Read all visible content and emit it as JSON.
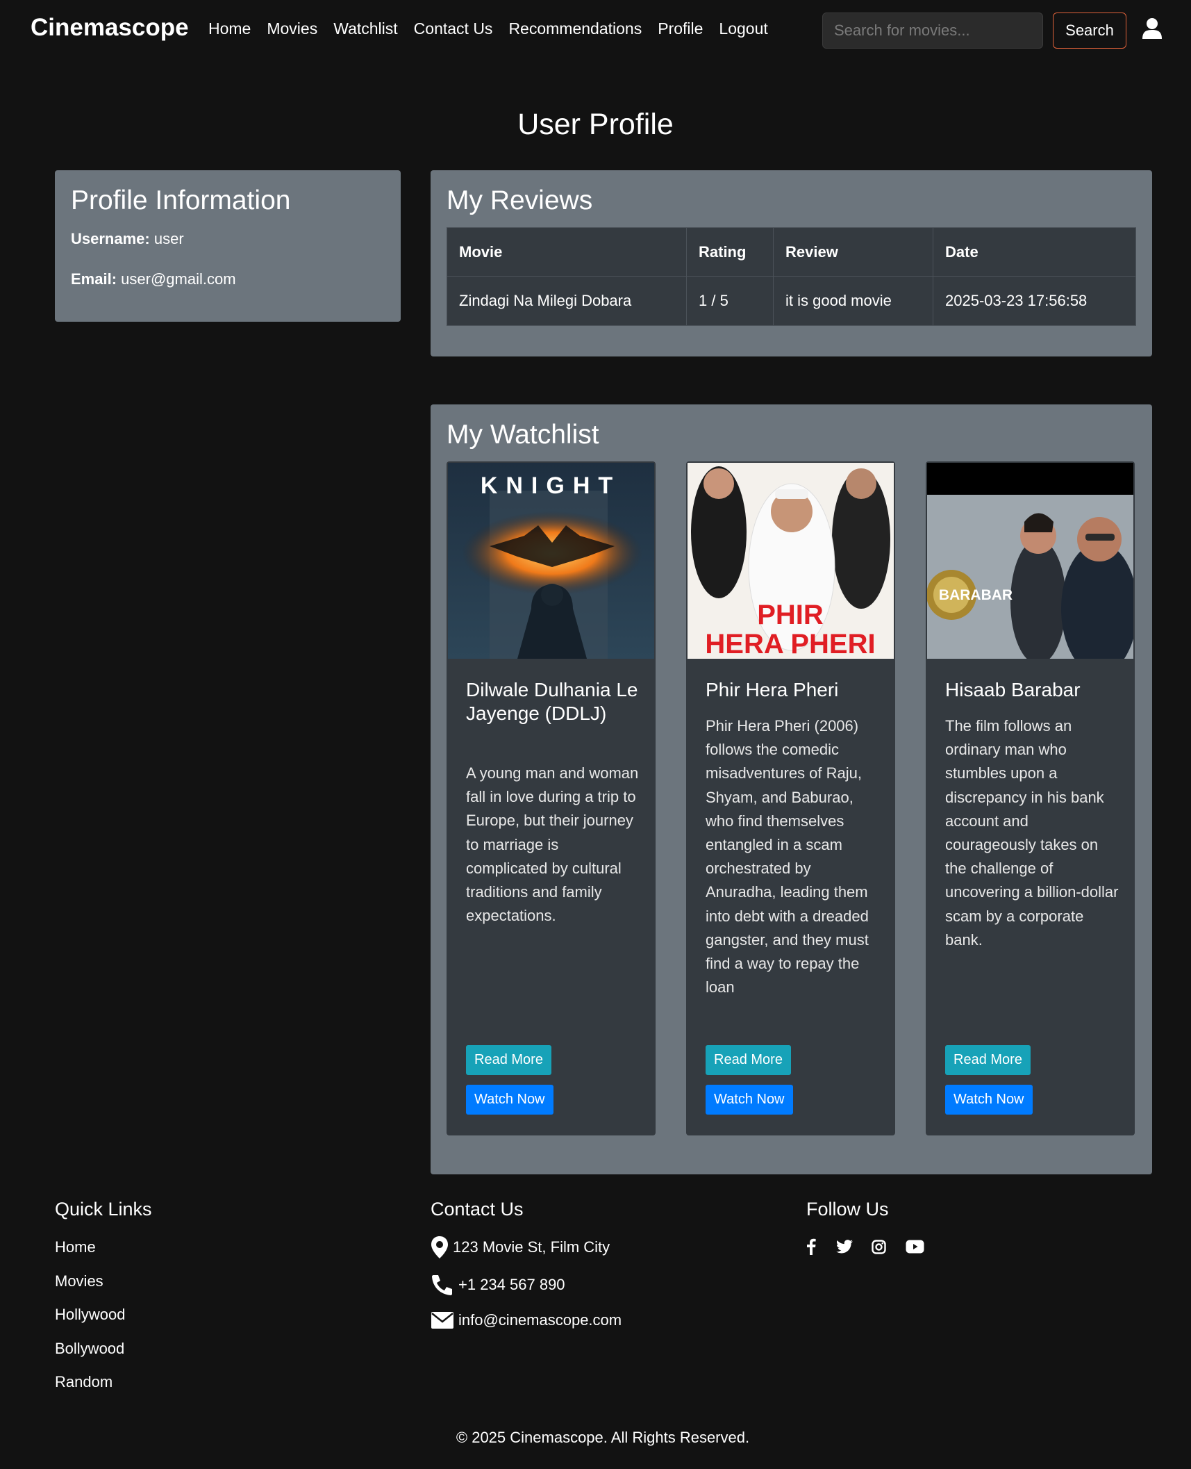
{
  "navbar": {
    "brand": "Cinemascope",
    "links": [
      "Home",
      "Movies",
      "Watchlist",
      "Contact Us",
      "Recommendations",
      "Profile",
      "Logout"
    ],
    "search_placeholder": "Search for movies...",
    "search_button": "Search"
  },
  "page_title": "User Profile",
  "profile": {
    "heading": "Profile Information",
    "username_label": "Username:",
    "username": "user",
    "email_label": "Email:",
    "email": "user@gmail.com"
  },
  "reviews": {
    "heading": "My Reviews",
    "columns": [
      "Movie",
      "Rating",
      "Review",
      "Date"
    ],
    "rows": [
      [
        "Zindagi Na Milegi Dobara",
        "1 / 5",
        "it is good movie",
        "2025-03-23 17:56:58"
      ]
    ]
  },
  "watchlist": {
    "heading": "My Watchlist",
    "read_more": "Read More",
    "watch_now": "Watch Now",
    "items": [
      {
        "title": "Dilwale Dulhania Le Jayenge (DDLJ)",
        "description": "A young man and woman fall in love during a trip to Europe, but their journey to marriage is complicated by cultural traditions and family expectations.",
        "poster_text": [
          "KNIGHT"
        ]
      },
      {
        "title": "Phir Hera Pheri",
        "description": "Phir Hera Pheri (2006) follows the comedic misadventures of Raju, Shyam, and Baburao, who find themselves entangled in a scam orchestrated by Anuradha, leading them into debt with a dreaded gangster, and they must find a way to repay the loan",
        "poster_text": [
          "PHIR",
          "HERA PHERI"
        ]
      },
      {
        "title": "Hisaab Barabar",
        "description": "The film follows an ordinary man who stumbles upon a discrepancy in his bank account and courageously takes on the challenge of uncovering a billion-dollar scam by a corporate bank.",
        "poster_text": [
          "BARABAR"
        ]
      }
    ]
  },
  "footer": {
    "quick_links_heading": "Quick Links",
    "quick_links": [
      "Home",
      "Movies",
      "Hollywood",
      "Bollywood",
      "Random"
    ],
    "contact_heading": "Contact Us",
    "address": "123 Movie St, Film City",
    "phone": "+1 234 567 890",
    "email": "info@cinemascope.com",
    "follow_heading": "Follow Us",
    "socials": [
      "facebook-icon",
      "twitter-icon",
      "instagram-icon",
      "youtube-icon"
    ],
    "copyright": "© 2025 Cinemascope. All Rights Reserved."
  }
}
